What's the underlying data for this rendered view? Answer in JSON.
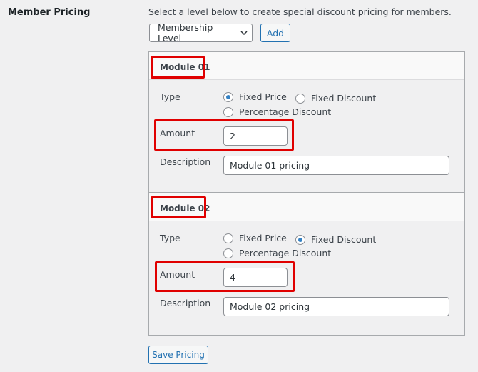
{
  "row_label": "Member Pricing",
  "intro_text": "Select a level below to create special discount pricing for members.",
  "level_select": {
    "selected": "Membership Level",
    "icon": "chevron-down-icon"
  },
  "add_button": "Add",
  "save_button": "Save Pricing",
  "highlight_color": "#e00000",
  "accent_color": "#2271b1",
  "modules": [
    {
      "title": "Module 01",
      "type_label": "Type",
      "type_options": [
        "Fixed Price",
        "Fixed Discount",
        "Percentage Discount"
      ],
      "selected_type": "Fixed Price",
      "amount_label": "Amount",
      "amount_value": "2",
      "description_label": "Description",
      "description_value": "Module 01 pricing"
    },
    {
      "title": "Module 02",
      "type_label": "Type",
      "type_options": [
        "Fixed Price",
        "Fixed Discount",
        "Percentage Discount"
      ],
      "selected_type": "Fixed Discount",
      "amount_label": "Amount",
      "amount_value": "4",
      "description_label": "Description",
      "description_value": "Module 02 pricing"
    }
  ]
}
